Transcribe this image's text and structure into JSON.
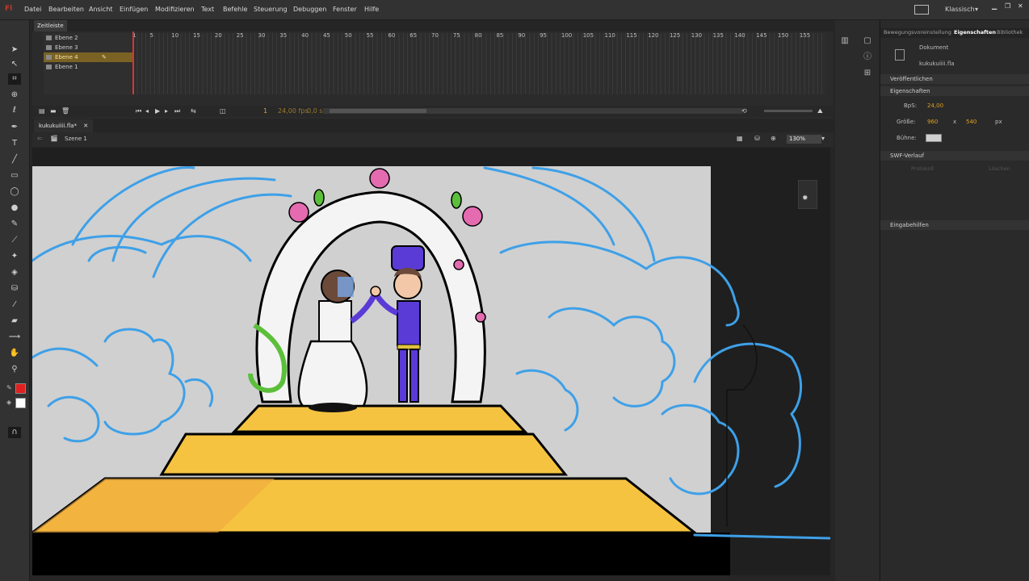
{
  "app": {
    "logo": "Fl"
  },
  "menubar": {
    "items": [
      "Datei",
      "Bearbeiten",
      "Ansicht",
      "Einfügen",
      "Modifizieren",
      "Text",
      "Befehle",
      "Steuerung",
      "Debuggen",
      "Fenster",
      "Hilfe"
    ],
    "workspace": "Klassisch"
  },
  "timeline": {
    "tab": "Zeitleiste",
    "layers": [
      "Ebene 2",
      "Ebene 3",
      "Ebene 4",
      "Ebene 1"
    ],
    "selected_layer": "Ebene 4",
    "ruler": [
      "1",
      "5",
      "10",
      "15",
      "20",
      "25",
      "30",
      "35",
      "40",
      "45",
      "50",
      "55",
      "60",
      "65",
      "70",
      "75",
      "80",
      "85",
      "90",
      "95",
      "100",
      "105",
      "110",
      "115",
      "120",
      "125",
      "130",
      "135",
      "140",
      "145",
      "150",
      "155"
    ],
    "current_frame": "1",
    "fps": "24,00 fps",
    "time": "0,0 s"
  },
  "document": {
    "tab": "kukukuiiii.fla*",
    "scene": "Szene 1",
    "zoom": "130%"
  },
  "properties": {
    "tabs": [
      "Bewegungsvoreinstellung",
      "Eigenschaften",
      "Bibliothek"
    ],
    "active_tab": "Eigenschaften",
    "doc_type": "Dokument",
    "doc_name": "kukukuiiii.fla",
    "sections": {
      "publish": "Veröffentlichen",
      "props": "Eigenschaften",
      "swf": "SWF-Verlauf",
      "access": "Eingabehilfen"
    },
    "fps_label": "BpS:",
    "fps_value": "24,00",
    "size_label": "Größe:",
    "width": "960",
    "x_sep": "x",
    "height": "540",
    "unit": "px",
    "stage_label": "Bühne:",
    "stage_color": "#d0d0d0",
    "swf_buttons": [
      "Protokoll",
      "Löschen"
    ]
  },
  "colors": {
    "accent_layer": "#7a6224",
    "stroke": "#e02020",
    "fill": "#ffffff",
    "sketch_blue": "#3ea0e8",
    "steps_yellow": "#f5c340",
    "groom_purple": "#5a3bd6"
  }
}
